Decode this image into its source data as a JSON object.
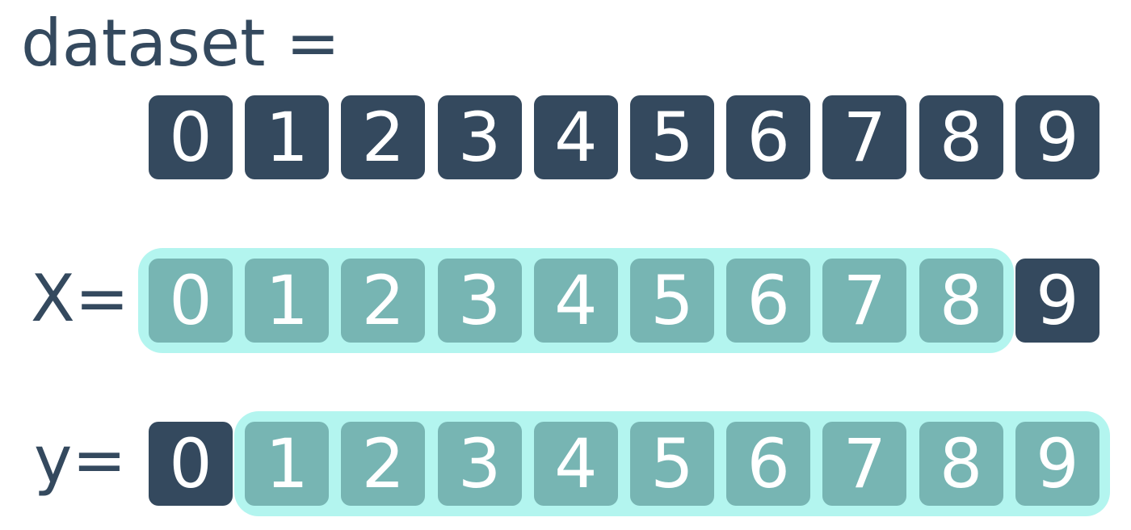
{
  "labels": {
    "dataset": "dataset =",
    "x": "X=",
    "y": "y="
  },
  "colors": {
    "dark": "#34495e",
    "highlight": "#77b5b3",
    "glow": "#b3f5ef",
    "text_on_cell": "#ffffff"
  },
  "rows": [
    {
      "id": "dataset",
      "cells": [
        {
          "value": "0",
          "style": "dark"
        },
        {
          "value": "1",
          "style": "dark"
        },
        {
          "value": "2",
          "style": "dark"
        },
        {
          "value": "3",
          "style": "dark"
        },
        {
          "value": "4",
          "style": "dark"
        },
        {
          "value": "5",
          "style": "dark"
        },
        {
          "value": "6",
          "style": "dark"
        },
        {
          "value": "7",
          "style": "dark"
        },
        {
          "value": "8",
          "style": "dark"
        },
        {
          "value": "9",
          "style": "dark"
        }
      ],
      "highlight_range": null
    },
    {
      "id": "x",
      "cells": [
        {
          "value": "0",
          "style": "teal"
        },
        {
          "value": "1",
          "style": "teal"
        },
        {
          "value": "2",
          "style": "teal"
        },
        {
          "value": "3",
          "style": "teal"
        },
        {
          "value": "4",
          "style": "teal"
        },
        {
          "value": "5",
          "style": "teal"
        },
        {
          "value": "6",
          "style": "teal"
        },
        {
          "value": "7",
          "style": "teal"
        },
        {
          "value": "8",
          "style": "teal"
        },
        {
          "value": "9",
          "style": "dark"
        }
      ],
      "highlight_range": [
        0,
        8
      ]
    },
    {
      "id": "y",
      "cells": [
        {
          "value": "0",
          "style": "dark"
        },
        {
          "value": "1",
          "style": "teal"
        },
        {
          "value": "2",
          "style": "teal"
        },
        {
          "value": "3",
          "style": "teal"
        },
        {
          "value": "4",
          "style": "teal"
        },
        {
          "value": "5",
          "style": "teal"
        },
        {
          "value": "6",
          "style": "teal"
        },
        {
          "value": "7",
          "style": "teal"
        },
        {
          "value": "8",
          "style": "teal"
        },
        {
          "value": "9",
          "style": "teal"
        }
      ],
      "highlight_range": [
        1,
        9
      ]
    }
  ]
}
